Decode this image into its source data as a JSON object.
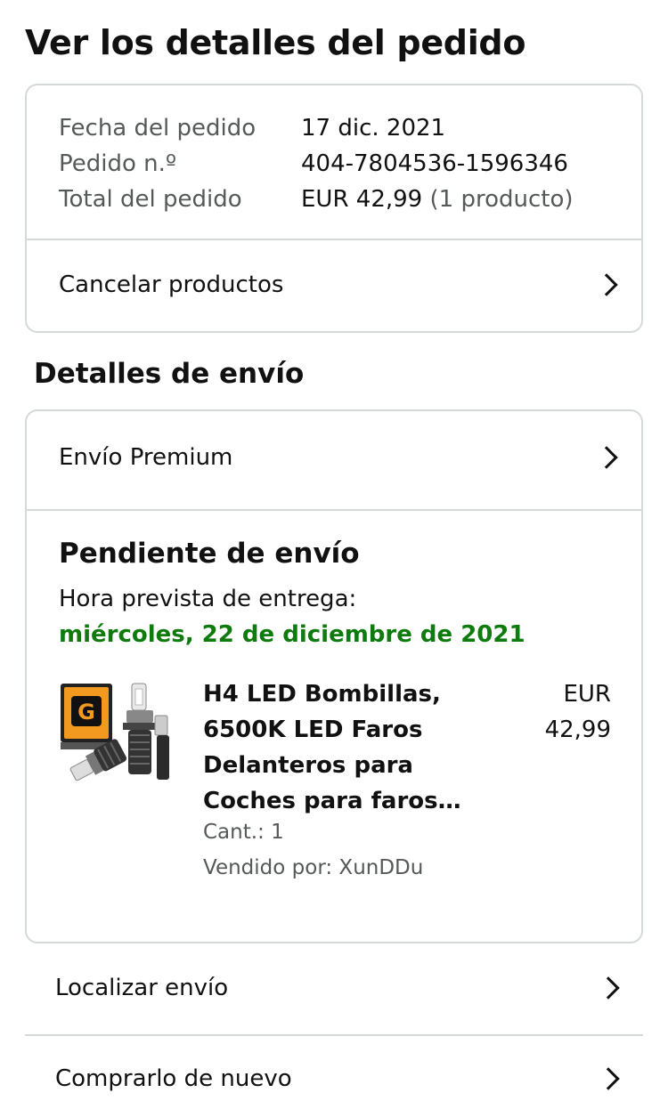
{
  "page": {
    "title": "Ver los detalles del pedido"
  },
  "summary": {
    "rows": [
      {
        "label": "Fecha del pedido",
        "value": "17 dic. 2021"
      },
      {
        "label": "Pedido n.º",
        "value": "404-7804536-1596346"
      },
      {
        "label": "Total del pedido",
        "value": "EUR 42,99",
        "extra": "(1 producto)"
      }
    ],
    "cancel_label": "Cancelar productos"
  },
  "shipping": {
    "heading": "Detalles de envío",
    "method_label": "Envío Premium",
    "status": "Pendiente de envío",
    "delivery_label": "Hora prevista de entrega:",
    "delivery_date": "miércoles, 22 de diciembre de 2021",
    "delivery_date_color": "#0f7b0f"
  },
  "product": {
    "title": "H4 LED Bombillas, 6500K LED Faros Delanteros para Coches para faros…",
    "price_currency": "EUR",
    "price_amount": "42,99",
    "quantity": "Cant.: 1",
    "seller": "Vendido por: XunDDu",
    "image": "product-led-bulbs-image"
  },
  "actions": {
    "track_label": "Localizar envío",
    "buy_again_label": "Comprarlo de nuevo"
  }
}
